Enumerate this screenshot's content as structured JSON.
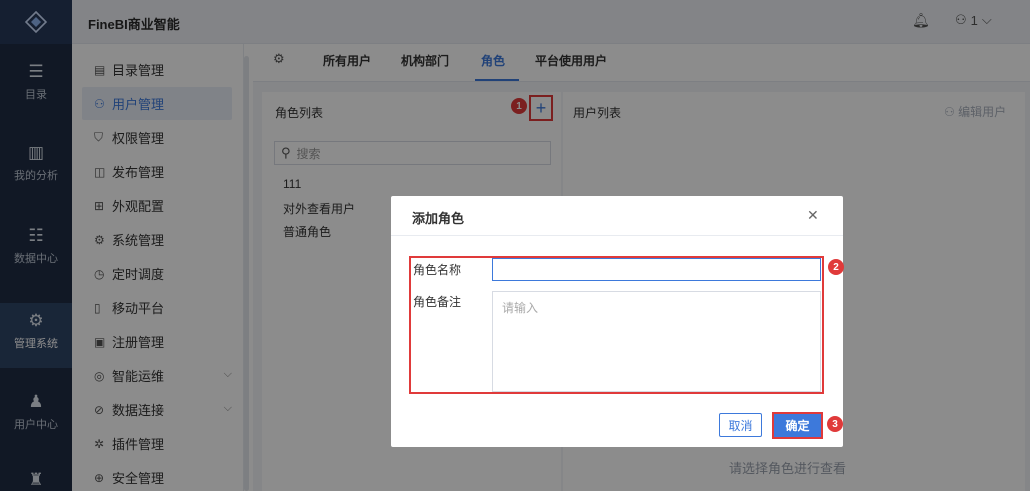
{
  "app": {
    "brand": "FineBI商业智能",
    "user_count": "1"
  },
  "rail": [
    {
      "label": "目录",
      "icon": "catalog-icon"
    },
    {
      "label": "我的分析",
      "icon": "analysis-icon"
    },
    {
      "label": "数据中心",
      "icon": "data-center-icon"
    },
    {
      "label": "管理系统",
      "icon": "gear-icon",
      "active": true
    },
    {
      "label": "用户中心",
      "icon": "user-center-icon"
    }
  ],
  "menu": [
    {
      "label": "目录管理",
      "icon": "directory-icon"
    },
    {
      "label": "用户管理",
      "icon": "users-icon",
      "active": true
    },
    {
      "label": "权限管理",
      "icon": "permission-icon"
    },
    {
      "label": "发布管理",
      "icon": "publish-icon"
    },
    {
      "label": "外观配置",
      "icon": "appearance-icon"
    },
    {
      "label": "系统管理",
      "icon": "system-icon"
    },
    {
      "label": "定时调度",
      "icon": "schedule-icon"
    },
    {
      "label": "移动平台",
      "icon": "mobile-icon"
    },
    {
      "label": "注册管理",
      "icon": "register-icon"
    },
    {
      "label": "智能运维",
      "icon": "ops-icon",
      "expandable": true
    },
    {
      "label": "数据连接",
      "icon": "data-connection-icon",
      "expandable": true
    },
    {
      "label": "插件管理",
      "icon": "plugin-icon"
    },
    {
      "label": "安全管理",
      "icon": "security-icon"
    }
  ],
  "tabs": [
    {
      "label": "所有用户"
    },
    {
      "label": "机构部门"
    },
    {
      "label": "角色",
      "active": true
    },
    {
      "label": "平台使用用户"
    }
  ],
  "role_panel": {
    "title": "角色列表",
    "search_placeholder": "搜索",
    "roles": [
      "111",
      "对外查看用户",
      "普通角色"
    ]
  },
  "user_panel": {
    "title": "用户列表",
    "edit_label": "编辑用户",
    "empty_hint": "请选择角色进行查看"
  },
  "dialog": {
    "title": "添加角色",
    "name_label": "角色名称",
    "name_value": "",
    "note_label": "角色备注",
    "note_placeholder": "请输入",
    "cancel_label": "取消",
    "ok_label": "确定"
  },
  "annotations": [
    "1",
    "2",
    "3"
  ],
  "colors": {
    "accent": "#3d79db",
    "highlight": "#e03a3a",
    "rail": "#1f2d44"
  }
}
